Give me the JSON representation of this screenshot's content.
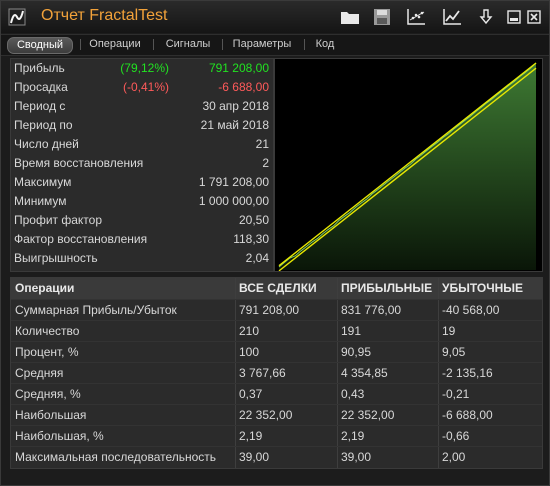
{
  "window": {
    "title": "Отчет FractalTest",
    "icons": [
      "folder-icon",
      "save-icon",
      "scatter-chart-icon",
      "line-chart-icon",
      "download-icon",
      "minimize-icon",
      "close-icon"
    ]
  },
  "tabs": [
    "Сводный",
    "Операции",
    "Сигналы",
    "Параметры",
    "Код"
  ],
  "active_tab": "Сводный",
  "summary": [
    {
      "label": "Прибыль",
      "pct": "(79,12%)",
      "value": "791 208,00",
      "color": "green"
    },
    {
      "label": "Просадка",
      "pct": "(-0,41%)",
      "value": "-6 688,00",
      "color": "red"
    },
    {
      "label": "Период с",
      "pct": "",
      "value": "30 апр 2018"
    },
    {
      "label": "Период по",
      "pct": "",
      "value": "21 май 2018"
    },
    {
      "label": "Число дней",
      "pct": "",
      "value": "21"
    },
    {
      "label": "Время восстановления",
      "pct": "",
      "value": "2"
    },
    {
      "label": "Максимум",
      "pct": "",
      "value": "1 791 208,00"
    },
    {
      "label": "Минимум",
      "pct": "",
      "value": "1 000 000,00"
    },
    {
      "label": "Профит фактор",
      "pct": "",
      "value": "20,50"
    },
    {
      "label": "Фактор восстановления",
      "pct": "",
      "value": "118,30"
    },
    {
      "label": "Выигрышность",
      "pct": "",
      "value": "2,04"
    }
  ],
  "chart_data": {
    "type": "area",
    "title": "",
    "xlabel": "",
    "ylabel": "",
    "x_range": [
      "30 апр 2018",
      "21 май 2018"
    ],
    "ylim": [
      1000000,
      1791208
    ],
    "fill_color": "#3e7a33",
    "trend_color": "#e8e800",
    "series": [
      {
        "values": [
          1000000,
          1018000,
          1035000,
          1044000,
          1063000,
          1079000,
          1096000,
          1110000,
          1129000,
          1146000,
          1160000,
          1181000,
          1197000,
          1212000,
          1232000,
          1248000,
          1263000,
          1283000,
          1299000,
          1316000,
          1333000,
          1349000,
          1366000,
          1383000,
          1398000,
          1418000,
          1434000,
          1451000,
          1468000,
          1484000,
          1502000,
          1517000,
          1536000,
          1552000,
          1569000,
          1585000,
          1603000,
          1619000,
          1637000,
          1652000,
          1670000,
          1687000,
          1704000,
          1719000,
          1738000,
          1754000,
          1771000,
          1791208
        ]
      }
    ],
    "trendlines": [
      {
        "from": 1005000,
        "to": 1791208
      },
      {
        "from": 985000,
        "to": 1771000
      }
    ]
  },
  "table": {
    "headers": [
      "Операции",
      "ВСЕ СДЕЛКИ",
      "ПРИБЫЛЬНЫЕ",
      "УБЫТОЧНЫЕ"
    ],
    "rows": [
      [
        "Суммарная Прибыль/Убыток",
        "791 208,00",
        "831 776,00",
        "-40 568,00"
      ],
      [
        "Количество",
        "210",
        "191",
        "19"
      ],
      [
        "Процент, %",
        "100",
        "90,95",
        "9,05"
      ],
      [
        "Средняя",
        "3 767,66",
        "4 354,85",
        "-2 135,16"
      ],
      [
        "Средняя, %",
        "0,37",
        "0,43",
        "-0,21"
      ],
      [
        "Наибольшая",
        "22 352,00",
        "22 352,00",
        "-6 688,00"
      ],
      [
        "Наибольшая, %",
        "2,19",
        "2,19",
        "-0,66"
      ],
      [
        "Максимальная последовательность",
        "39,00",
        "39,00",
        "2,00"
      ]
    ]
  }
}
